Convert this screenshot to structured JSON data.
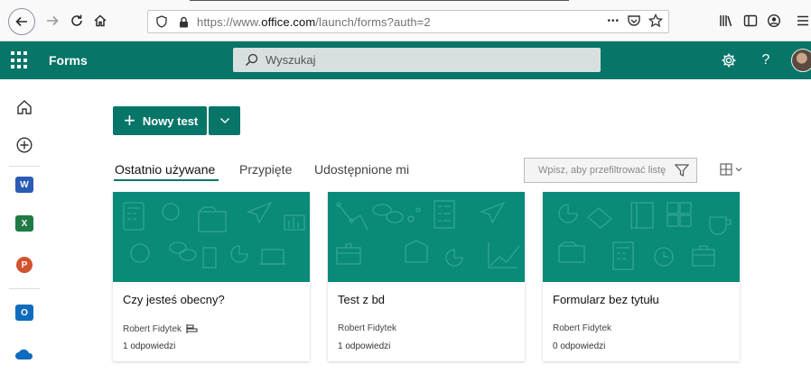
{
  "browser": {
    "url_prefix": "https://www.",
    "url_host": "office.com",
    "url_path": "/launch/forms?auth=2",
    "more_label": "•••"
  },
  "app": {
    "name": "Forms",
    "search_placeholder": "Wyszukaj",
    "help_label": "?",
    "accent": "#077568"
  },
  "rail": {
    "items": [
      {
        "name": "home"
      },
      {
        "name": "create"
      },
      {
        "name": "word",
        "letter": "W",
        "color": "#2b5cb5"
      },
      {
        "name": "excel",
        "letter": "X",
        "color": "#1f7a45"
      },
      {
        "name": "powerpoint",
        "letter": "P",
        "color": "#d35230"
      },
      {
        "name": "outlook",
        "letter": "O",
        "color": "#0f6cbd"
      },
      {
        "name": "onedrive",
        "color": "#0f6cbd"
      }
    ]
  },
  "main": {
    "new_button_label": "Nowy test",
    "tabs": [
      {
        "label": "Ostatnio używane",
        "active": true
      },
      {
        "label": "Przypięte",
        "active": false
      },
      {
        "label": "Udostępnione mi",
        "active": false
      }
    ],
    "filter_placeholder": "Wpisz, aby przefiltrować listę"
  },
  "cards": [
    {
      "title": "Czy jesteś obecny?",
      "owner": "Robert Fidytek",
      "shared": true,
      "responses": "1 odpowiedzi"
    },
    {
      "title": "Test z bd",
      "owner": "Robert Fidytek",
      "shared": false,
      "responses": "1 odpowiedzi"
    },
    {
      "title": "Formularz bez tytułu",
      "owner": "Robert Fidytek",
      "shared": false,
      "responses": "0 odpowiedzi"
    }
  ]
}
